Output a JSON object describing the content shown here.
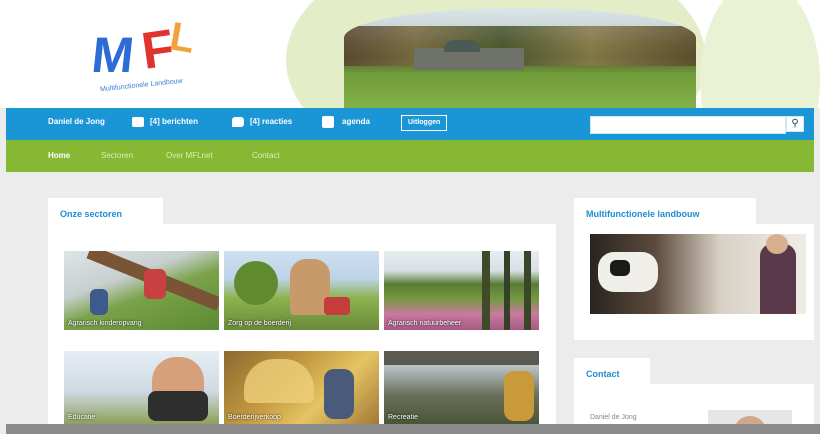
{
  "logo": {
    "text_m": "M",
    "text_f": "F",
    "text_l": "L",
    "tagline": "Multifunctionele Landbouw"
  },
  "topbar": {
    "user_name": "Daniel de Jong",
    "messages_label": "[4] berichten",
    "reactions_label": "[4] reacties",
    "agenda_label": "agenda",
    "logout_label": "Uitloggen",
    "search_placeholder": "",
    "search_value": "",
    "search_button_icon": "magnifier-icon"
  },
  "nav": {
    "items": [
      "Home",
      "Sectoren",
      "Over MFLnet",
      "Contact"
    ],
    "active": "Home"
  },
  "sections": {
    "title": "Onze sectoren",
    "tiles": [
      {
        "caption": "Agrarisch kinderopvang",
        "color_a": "#6f9a3e",
        "color_b": "#8c6a4a"
      },
      {
        "caption": "Zorg op de boerderij",
        "color_a": "#7aa24a",
        "color_b": "#c8a070"
      },
      {
        "caption": "Agrarisch natuurbeheer",
        "color_a": "#4f7a30",
        "color_b": "#c97aa0"
      },
      {
        "caption": "Educatie",
        "color_a": "#cfd8e2",
        "color_b": "#9a7a50"
      },
      {
        "caption": "Boerderijverkoop",
        "color_a": "#b08a3a",
        "color_b": "#e2c26a"
      },
      {
        "caption": "Recreatie",
        "color_a": "#8a8a7a",
        "color_b": "#4a5a3a"
      }
    ]
  },
  "sidebar": {
    "ml_title": "Multifunctionele landbouw",
    "contact_title": "Contact",
    "contact_name": "Daniel de Jong"
  }
}
